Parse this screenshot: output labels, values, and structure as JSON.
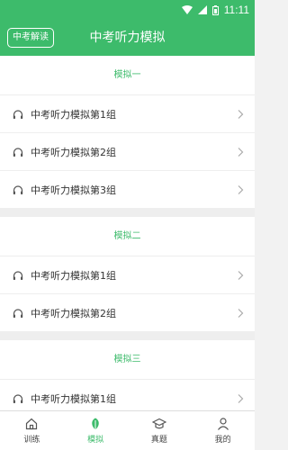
{
  "status_bar": {
    "time": "11:11"
  },
  "app_bar": {
    "left_button": "中考解读",
    "title": "中考听力模拟"
  },
  "sections": [
    {
      "title": "模拟一",
      "items": [
        "中考听力模拟第1组",
        "中考听力模拟第2组",
        "中考听力模拟第3组"
      ]
    },
    {
      "title": "模拟二",
      "items": [
        "中考听力模拟第1组",
        "中考听力模拟第2组"
      ]
    },
    {
      "title": "模拟三",
      "items": [
        "中考听力模拟第1组"
      ]
    }
  ],
  "tabs": [
    {
      "label": "训练",
      "icon": "home-icon",
      "active": false
    },
    {
      "label": "模拟",
      "icon": "leaf-icon",
      "active": true
    },
    {
      "label": "真题",
      "icon": "graduation-cap-icon",
      "active": false
    },
    {
      "label": "我的",
      "icon": "user-icon",
      "active": false
    }
  ],
  "colors": {
    "accent": "#3dbb6b",
    "text": "#333333",
    "divider": "#eeeeee"
  }
}
